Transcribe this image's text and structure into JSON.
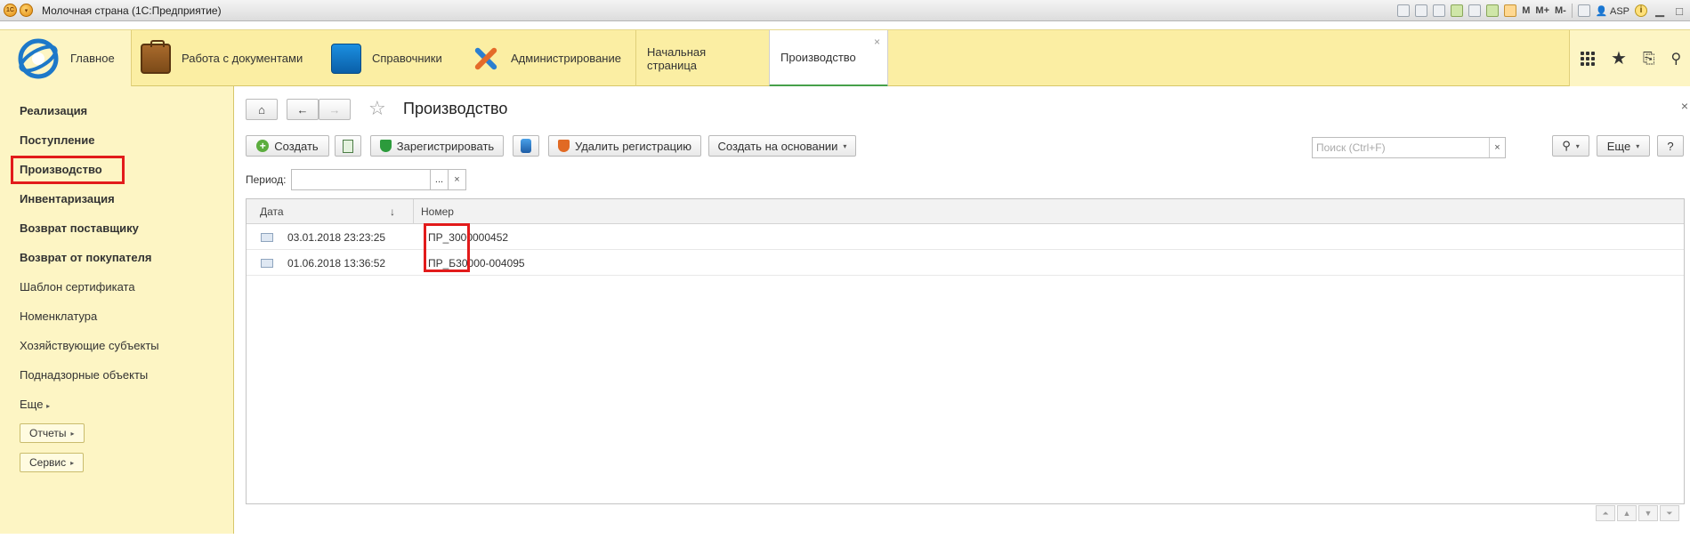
{
  "window": {
    "title": "Молочная страна  (1С:Предприятие)",
    "user": "ASP",
    "tb_m": [
      "M",
      "M+",
      "M-"
    ]
  },
  "topnav": {
    "home_label": "Главное",
    "docs_label": "Работа с документами",
    "ref_label": "Справочники",
    "admin_label": "Администрирование",
    "tab_start": "Начальная страница",
    "tab_prod": "Производство",
    "tab_close": "×"
  },
  "sidebar": {
    "items": [
      {
        "label": "Реализация"
      },
      {
        "label": "Поступление"
      },
      {
        "label": "Производство"
      },
      {
        "label": "Инвентаризация"
      },
      {
        "label": "Возврат поставщику"
      },
      {
        "label": "Возврат от покупателя"
      },
      {
        "label": "Шаблон сертификата"
      },
      {
        "label": "Номенклатура"
      },
      {
        "label": "Хозяйствующие субъекты"
      },
      {
        "label": "Поднадзорные объекты"
      },
      {
        "label": "Еще"
      }
    ],
    "reports_btn": "Отчеты",
    "service_btn": "Сервис"
  },
  "content": {
    "title": "Производство",
    "toolbar": {
      "create": "Создать",
      "register": "Зарегистрировать",
      "delete_reg": "Удалить регистрацию",
      "create_based": "Создать на основании",
      "search_placeholder": "Поиск (Ctrl+F)",
      "more": "Еще",
      "help": "?"
    },
    "period_label": "Период:",
    "period_dots": "...",
    "period_clear": "×",
    "table": {
      "columns": [
        "Дата",
        "Номер"
      ],
      "rows": [
        {
          "date": "03.01.2018 23:23:25",
          "number": "ПР_3000000452"
        },
        {
          "date": "01.06.2018 13:36:52",
          "number": "ПР_Б30000-004095"
        }
      ]
    }
  }
}
